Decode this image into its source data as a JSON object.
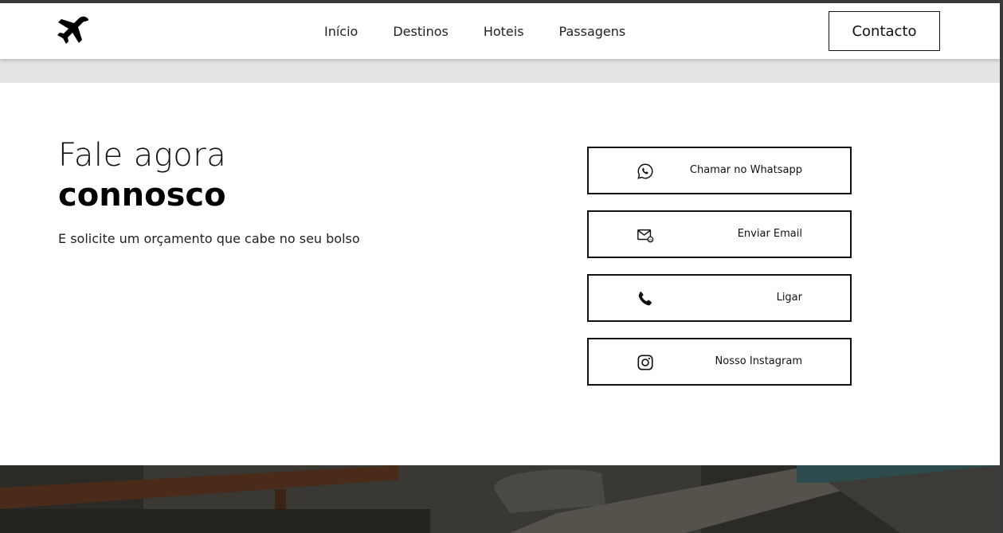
{
  "nav": {
    "logo_icon": "airplane-icon",
    "links": [
      "Início",
      "Destinos",
      "Hoteis",
      "Passagens"
    ],
    "contact_label": "Contacto"
  },
  "hero": {
    "title_light": "Fale agora",
    "title_bold": "connosco",
    "subtitle": "E solicite um orçamento que cabe no seu bolso"
  },
  "actions": [
    {
      "label": "Chamar no Whatsapp",
      "icon": "whatsapp-icon"
    },
    {
      "label": "Enviar Email",
      "icon": "email-icon"
    },
    {
      "label": "Ligar",
      "icon": "phone-icon"
    },
    {
      "label": "Nosso Instagram",
      "icon": "instagram-icon"
    }
  ],
  "colors": {
    "text": "#111111",
    "gray_band": "#e3e3e3",
    "photo_dark": "#2b2a27"
  }
}
